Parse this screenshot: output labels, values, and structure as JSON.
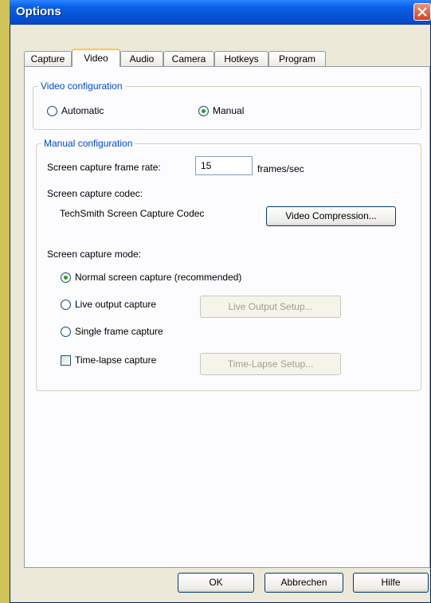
{
  "window": {
    "title": "Options"
  },
  "tabs": [
    {
      "label": "Capture",
      "active": false
    },
    {
      "label": "Video",
      "active": true
    },
    {
      "label": "Audio",
      "active": false
    },
    {
      "label": "Camera",
      "active": false
    },
    {
      "label": "Hotkeys",
      "active": false
    },
    {
      "label": "Program",
      "active": false
    }
  ],
  "video_config": {
    "title": "Video configuration",
    "automatic_label": "Automatic",
    "manual_label": "Manual",
    "selected": "manual"
  },
  "manual_config": {
    "title": "Manual configuration",
    "frame_rate_label": "Screen capture frame rate:",
    "frame_rate_value": "15",
    "frame_rate_unit": "frames/sec",
    "codec_label": "Screen capture codec:",
    "codec_value": "TechSmith Screen Capture Codec",
    "video_compression_button": "Video Compression...",
    "mode_label": "Screen capture mode:",
    "mode_normal": "Normal screen capture (recommended)",
    "mode_live": "Live output capture",
    "live_setup_button": "Live Output Setup...",
    "mode_single": "Single frame capture",
    "timelapse_label": "Time-lapse capture",
    "timelapse_setup_button": "Time-Lapse Setup...",
    "selected_mode": "normal",
    "timelapse_checked": false
  },
  "buttons": {
    "ok": "OK",
    "cancel": "Abbrechen",
    "help": "Hilfe"
  },
  "colors": {
    "titlebar": "#0552d4",
    "group_title": "#0046d5",
    "radio_selected": "#21a121",
    "background": "#ece9d8"
  }
}
